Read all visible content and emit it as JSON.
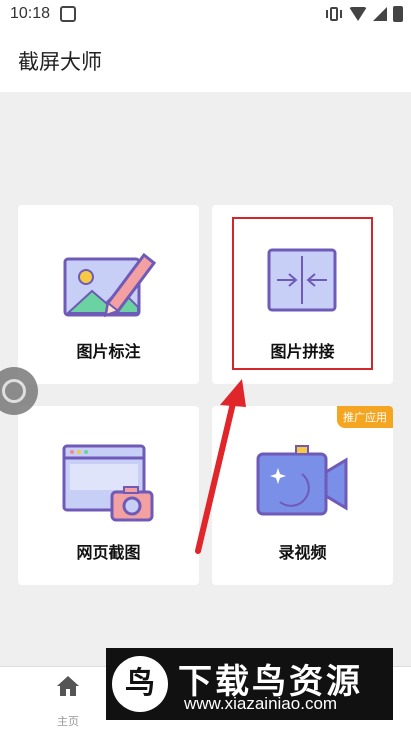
{
  "status_bar": {
    "time": "10:18"
  },
  "header": {
    "title": "截屏大师"
  },
  "cards": [
    {
      "label": "图片标注",
      "icon": "image-annotate-icon"
    },
    {
      "label": "图片拼接",
      "icon": "image-stitch-icon"
    },
    {
      "label": "网页截图",
      "icon": "webpage-screenshot-icon"
    },
    {
      "label": "录视频",
      "icon": "record-video-icon",
      "badge": "推广应用"
    }
  ],
  "bottom_nav": {
    "home_label": "主页"
  },
  "watermark": {
    "logo": "鸟",
    "title": "下载鸟资源",
    "url": "www.xiazainiao.com"
  },
  "colors": {
    "highlight": "#d2262a",
    "badge": "#f4a623",
    "icon_purple": "#6f5ab8",
    "icon_blue": "#c8cff7"
  }
}
